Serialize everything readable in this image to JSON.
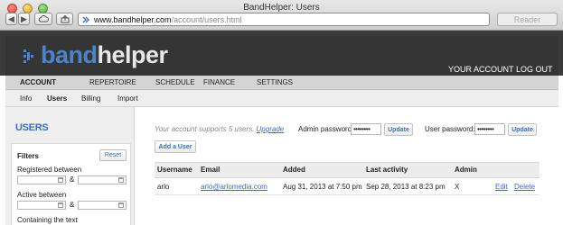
{
  "window": {
    "title": "BandHelper: Users",
    "url_host": "www.bandhelper.com",
    "url_path": "/account/users.html",
    "reader_label": "Reader"
  },
  "header": {
    "logo_band": "band",
    "logo_helper": "helper",
    "links": [
      "YOUR ACCOUNT",
      "LOG OUT"
    ]
  },
  "nav": {
    "items": [
      "ACCOUNT",
      "REPERTOIRE",
      "SCHEDULE",
      "FINANCE",
      "SETTINGS"
    ],
    "active": "ACCOUNT"
  },
  "subnav": {
    "items": [
      "Info",
      "Users",
      "Billing",
      "Import"
    ],
    "active": "Users"
  },
  "sidebar": {
    "title": "USERS",
    "filters_title": "Filters",
    "reset_label": "Reset",
    "registered_label": "Registered between",
    "active_label": "Active between",
    "containing_label": "Containing the text",
    "amp": "&"
  },
  "main": {
    "note_text": "Your account supports 5 users.",
    "upgrade_label": "Upgrade",
    "admin_password_label": "Admin password:",
    "admin_password_value": "••••••••",
    "user_password_label": "User password:",
    "user_password_value": "••••••••",
    "update_label": "Update",
    "add_user_label": "Add a User"
  },
  "table": {
    "headers": [
      "Username",
      "Email",
      "Added",
      "Last activity",
      "Admin"
    ],
    "rows": [
      {
        "username": "arlo",
        "email": "arlo@arlomedia.com",
        "added": "Aug 31, 2013 at 7:50 pm",
        "last_activity": "Sep 28, 2013 at 8:23 pm",
        "admin": "X",
        "edit": "Edit",
        "delete": "Delete"
      }
    ]
  },
  "colors": {
    "accent": "#3a6fbf",
    "header_bg": "#353535",
    "logo_blue": "#4d84c9"
  }
}
